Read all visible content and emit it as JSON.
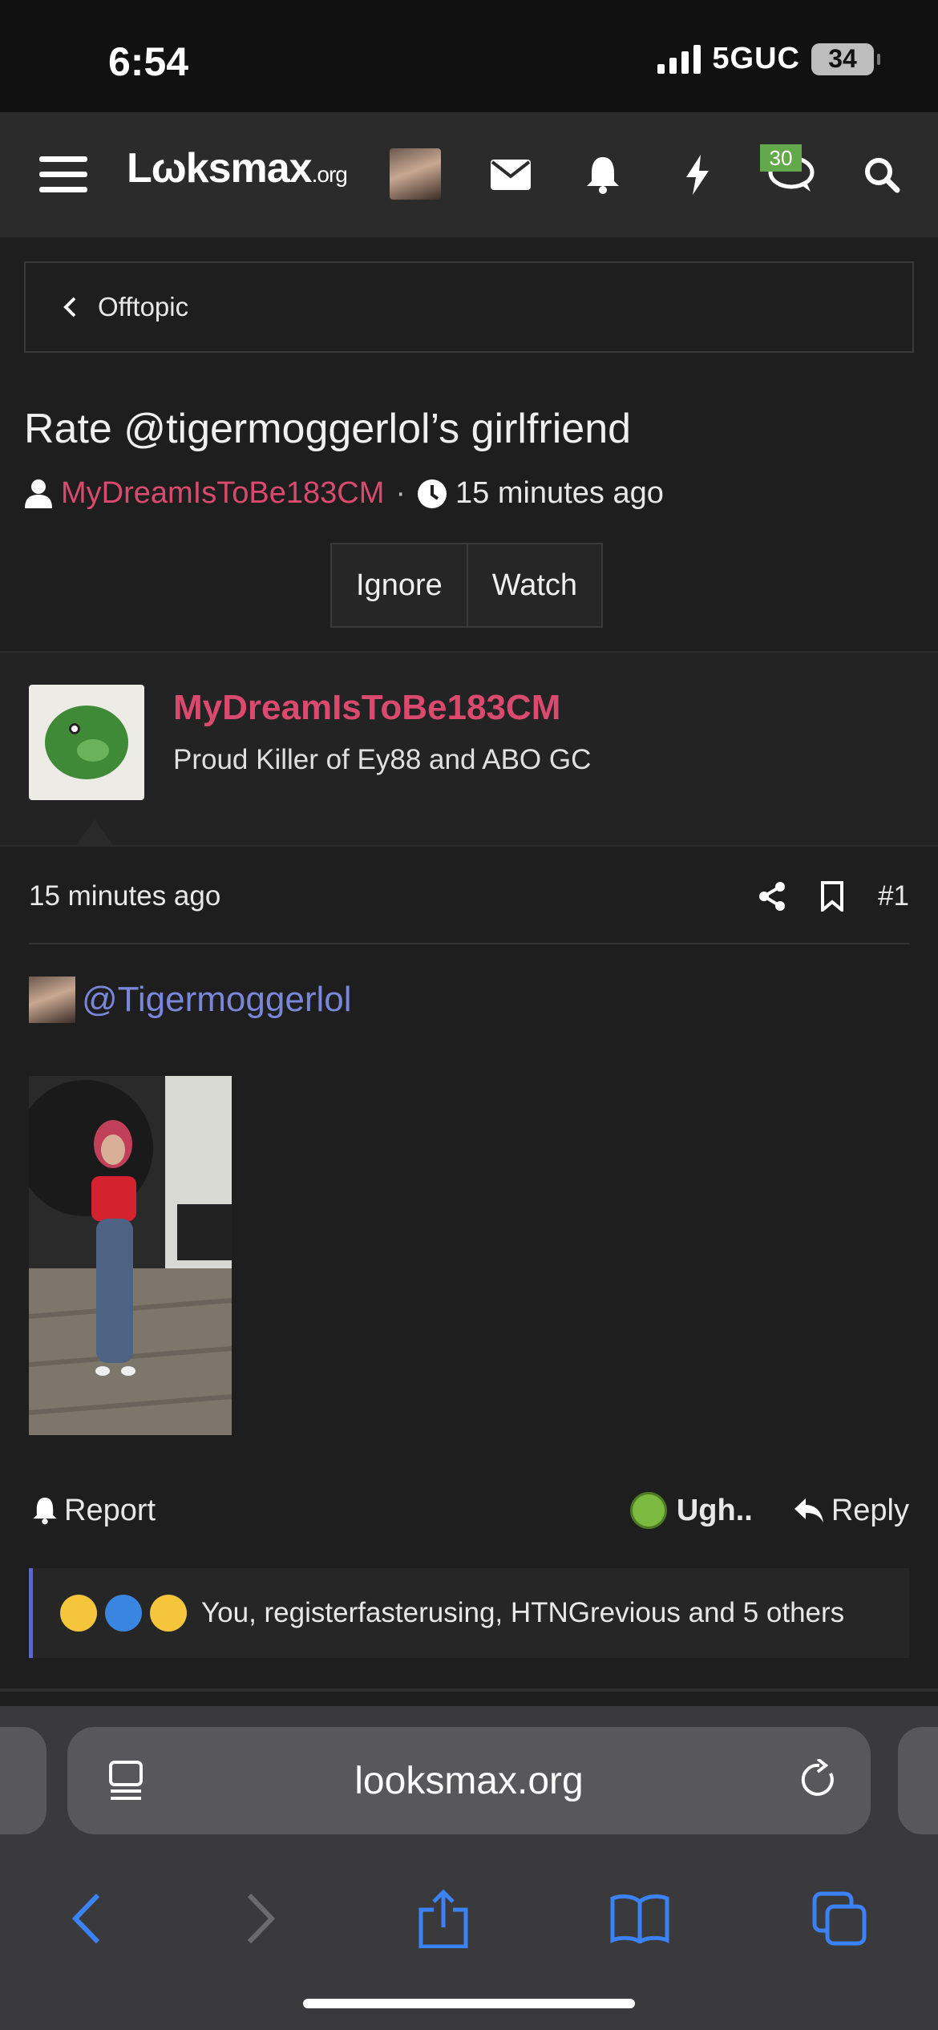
{
  "status_bar": {
    "time": "6:54",
    "network": "5GUC",
    "battery": "34"
  },
  "nav": {
    "logo_text": "Lωksmax",
    "logo_suffix": ".org",
    "chat_badge": "30"
  },
  "breadcrumb": {
    "label": "Offtopic"
  },
  "thread": {
    "title": "Rate @tigermoggerlol’s girlfriend",
    "author": "MyDreamIsToBe183CM",
    "separator": "·",
    "time": "15 minutes ago",
    "ignore_label": "Ignore",
    "watch_label": "Watch"
  },
  "post": {
    "username": "MyDreamIsToBe183CM",
    "user_title": "Proud Killer of Ey88 and ABO GC",
    "time": "15 minutes ago",
    "number": "#1",
    "mention": "@Tigermoggerlol",
    "report_label": "Report",
    "reaction_label": "Ugh..",
    "reply_label": "Reply",
    "reactions_text": "You, registerfasterusing, HTNGrevious and 5 others"
  },
  "browser": {
    "url": "looksmax.org"
  },
  "colors": {
    "author": "#d94a6e",
    "mention": "#7a86d8",
    "badge": "#63a94b",
    "ios_blue": "#3b82f6"
  }
}
